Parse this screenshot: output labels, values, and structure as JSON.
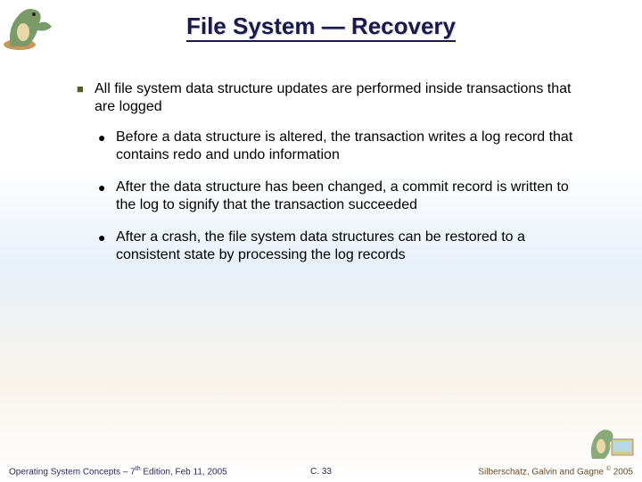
{
  "title": "File System — Recovery",
  "bullets": {
    "main": "All file system data structure updates are performed inside transactions that are logged",
    "sub1": "Before a data structure is altered, the transaction writes a log record that contains redo and undo information",
    "sub2": "After the data structure has been changed, a commit record is written to the log to signify that the transaction succeeded",
    "sub3": "After a crash, the file system data structures can be restored to a consistent state by processing the log records"
  },
  "footer": {
    "left_pre": "Operating System Concepts – 7",
    "left_sup": "th",
    "left_post": " Edition, Feb 11, 2005",
    "center": "C. 33",
    "right_pre": "Silberschatz, Galvin and Gagne ",
    "right_sup": "©",
    "right_post": " 2005"
  }
}
